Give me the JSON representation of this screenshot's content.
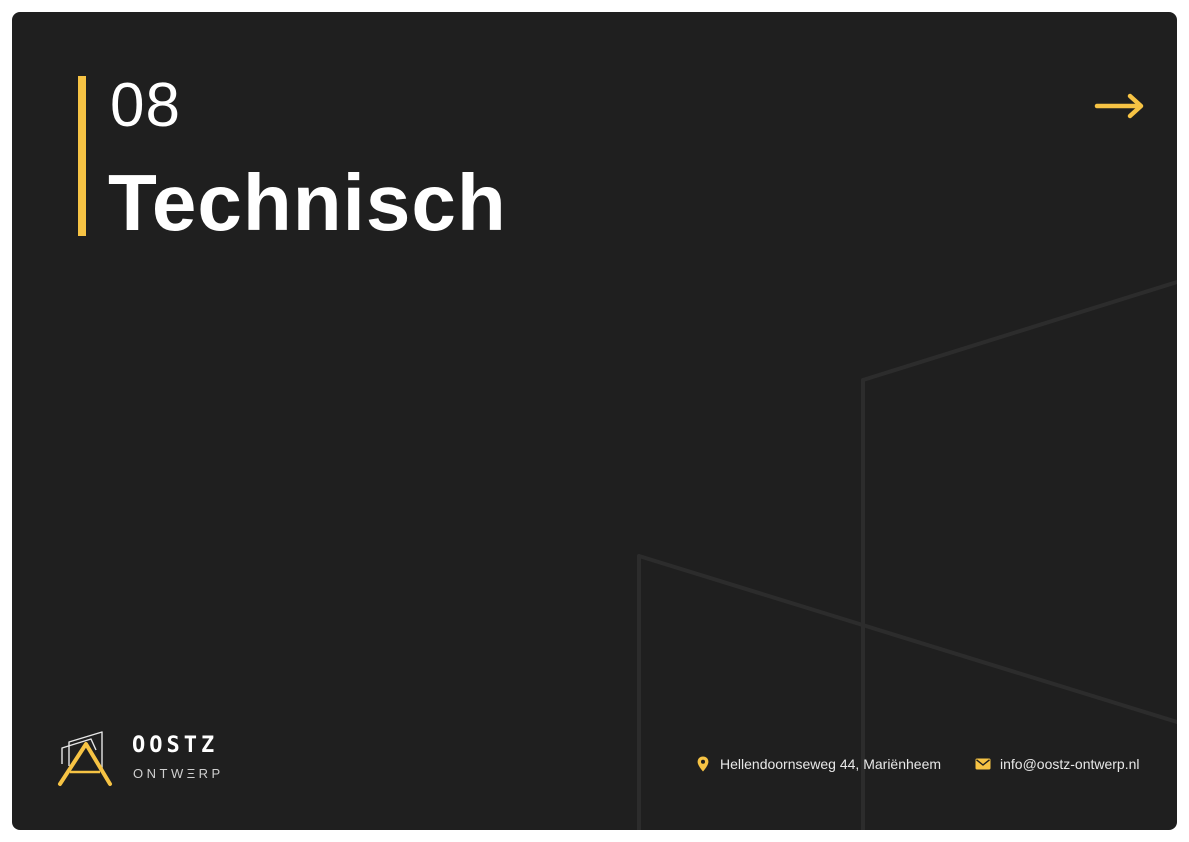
{
  "section": {
    "number": "08",
    "title": "Technisch"
  },
  "logo": {
    "name": "OOSTZ",
    "subtitle": "ONTWΞRP"
  },
  "contact": {
    "address": "Hellendoornseweg 44, Mariënheem",
    "email": "info@oostz-ontwerp.nl"
  },
  "colors": {
    "background": "#1f1f1f",
    "accent": "#f6c344",
    "text": "#ffffff"
  },
  "icons": {
    "next": "arrow-right-icon",
    "address": "location-pin-icon",
    "email": "envelope-icon",
    "logo": "oostz-logo-mark-icon"
  }
}
